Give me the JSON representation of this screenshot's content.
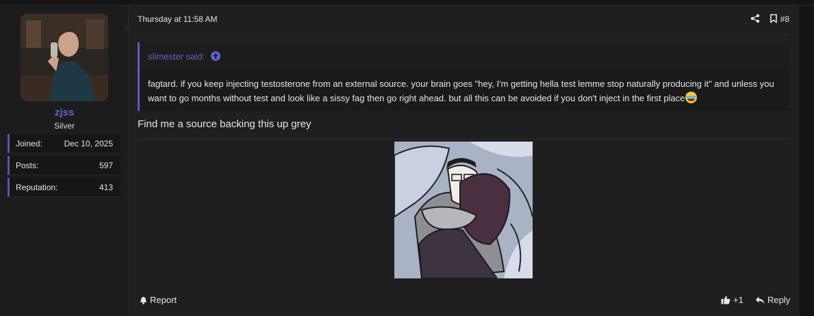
{
  "user": {
    "avatar_icon": "user-avatar-photo",
    "name": "zjss",
    "title": "Silver",
    "stats": [
      {
        "label": "Joined:",
        "value": "Dec 10, 2025"
      },
      {
        "label": "Posts:",
        "value": "597"
      },
      {
        "label": "Reputation:",
        "value": "413"
      }
    ]
  },
  "post": {
    "date": "Thursday at 11:58 AM",
    "number": "#8",
    "icons": {
      "share": "share-icon",
      "bookmark": "bookmark-icon"
    },
    "quote": {
      "author": "slimester said:",
      "text": "fagtard. if you keep injecting testosterone from an external source. your brain goes \"hey, I'm getting hella test lemme stop naturally producing it\" and unless you want to go months without test and look like a sissy fag then go right ahead. but all this can be avoided if you don't inject in the first place",
      "emoji": "crying-laughing-emoji"
    },
    "text": "Find me a source backing this up grey",
    "image_icon": "comic-illustration-couple-hugging"
  },
  "footer": {
    "report": "Report",
    "like": "+1",
    "reply": "Reply"
  },
  "colors": {
    "accent": "#5c63c8",
    "background": "#1f1f1f"
  }
}
